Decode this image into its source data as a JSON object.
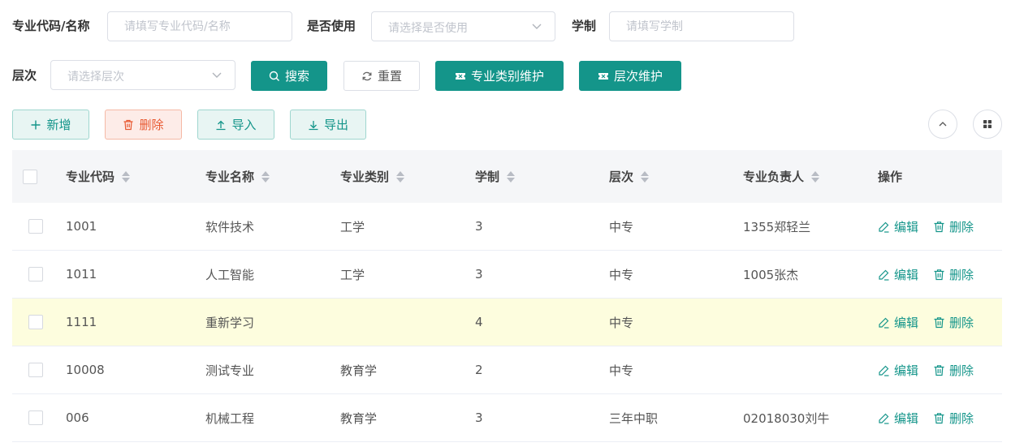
{
  "filters": {
    "major_label": "专业代码/名称",
    "major_placeholder": "请填写专业代码/名称",
    "in_use_label": "是否使用",
    "in_use_placeholder": "请选择是否使用",
    "duration_label": "学制",
    "duration_placeholder": "请填写学制",
    "level_label": "层次",
    "level_placeholder": "请选择层次"
  },
  "actions": {
    "search": "搜索",
    "reset": "重置",
    "category_maintain": "专业类别维护",
    "level_maintain": "层次维护"
  },
  "toolbar": {
    "add": "新增",
    "delete": "删除",
    "import": "导入",
    "export": "导出"
  },
  "table": {
    "columns": [
      "专业代码",
      "专业名称",
      "专业类别",
      "学制",
      "层次",
      "专业负责人",
      "操作"
    ],
    "rows": [
      {
        "code": "1001",
        "name": "软件技术",
        "category": "工学",
        "duration": "3",
        "level": "中专",
        "leader": "1355郑轻兰"
      },
      {
        "code": "1011",
        "name": "人工智能",
        "category": "工学",
        "duration": "3",
        "level": "中专",
        "leader": "1005张杰"
      },
      {
        "code": "1111",
        "name": "重新学习",
        "category": "",
        "duration": "4",
        "level": "中专",
        "leader": ""
      },
      {
        "code": "10008",
        "name": "测试专业",
        "category": "教育学",
        "duration": "2",
        "level": "中专",
        "leader": ""
      },
      {
        "code": "006",
        "name": "机械工程",
        "category": "教育学",
        "duration": "3",
        "level": "三年中职",
        "leader": "02018030刘牛"
      }
    ],
    "edit_label": "编辑",
    "delete_label": "删除"
  },
  "colors": {
    "primary": "#14958a",
    "danger": "#e8572f",
    "highlight_row": "#fdfdde"
  },
  "icons": {
    "search": "search-icon",
    "reset": "refresh-icon",
    "maintain": "ticket-icon",
    "add": "plus-icon",
    "delete": "trash-icon",
    "import": "upload-icon",
    "export": "download-icon",
    "collapse": "chevron-up-icon",
    "columns": "grid-icon",
    "edit": "edit-icon"
  }
}
